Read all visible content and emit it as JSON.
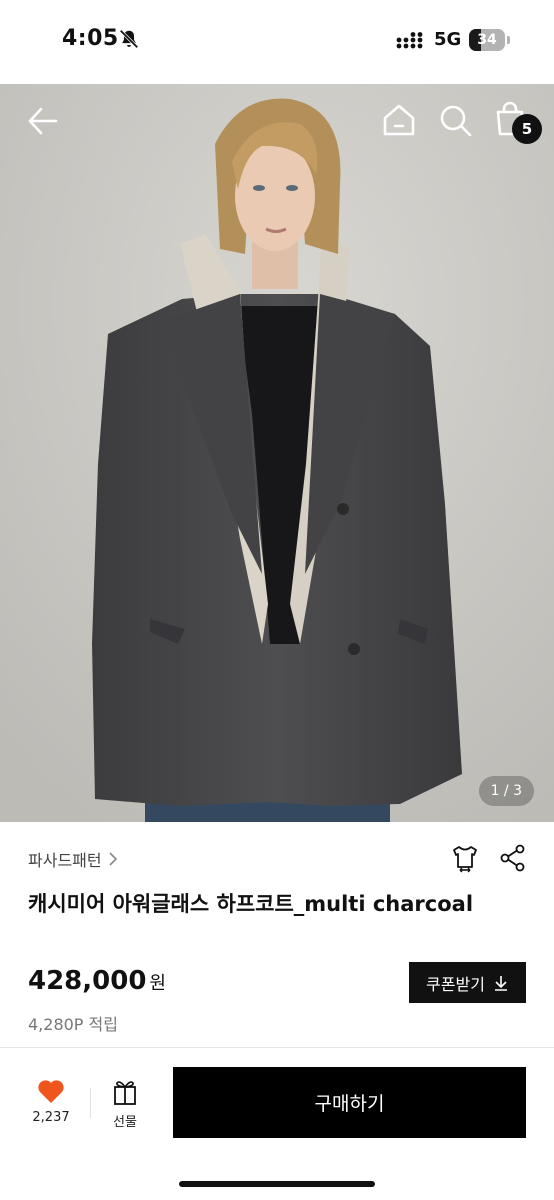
{
  "status_bar": {
    "time": "4:05",
    "network": "5G",
    "battery": "34",
    "battery_level": 0.34
  },
  "icons": {
    "back": "arrow-left-icon",
    "home": "home-icon",
    "search": "search-icon",
    "cart": "shopping-bag-icon",
    "brand_chevron": "chevron-right-icon",
    "size_guide": "tshirt-icon",
    "share": "share-icon",
    "coupon": "download-icon",
    "like": "heart-icon",
    "gift": "gift-icon"
  },
  "header": {
    "cart_count": "5"
  },
  "gallery": {
    "counter": "1 / 3",
    "current": 1,
    "total": 3
  },
  "product": {
    "brand": "파사드패턴",
    "title": "캐시미어 아워글래스 하프코트_multi charcoal",
    "price": "428,000",
    "price_unit": "원",
    "points": "4,280P 적립"
  },
  "actions": {
    "coupon_label": "쿠폰받기",
    "like_count": "2,237",
    "gift_label": "선물",
    "buy_label": "구매하기"
  },
  "colors": {
    "accent_heart": "#f0551e",
    "primary_button": "#000000",
    "coat": "#4a4a4c",
    "background_photo": "#cbc9c4"
  }
}
